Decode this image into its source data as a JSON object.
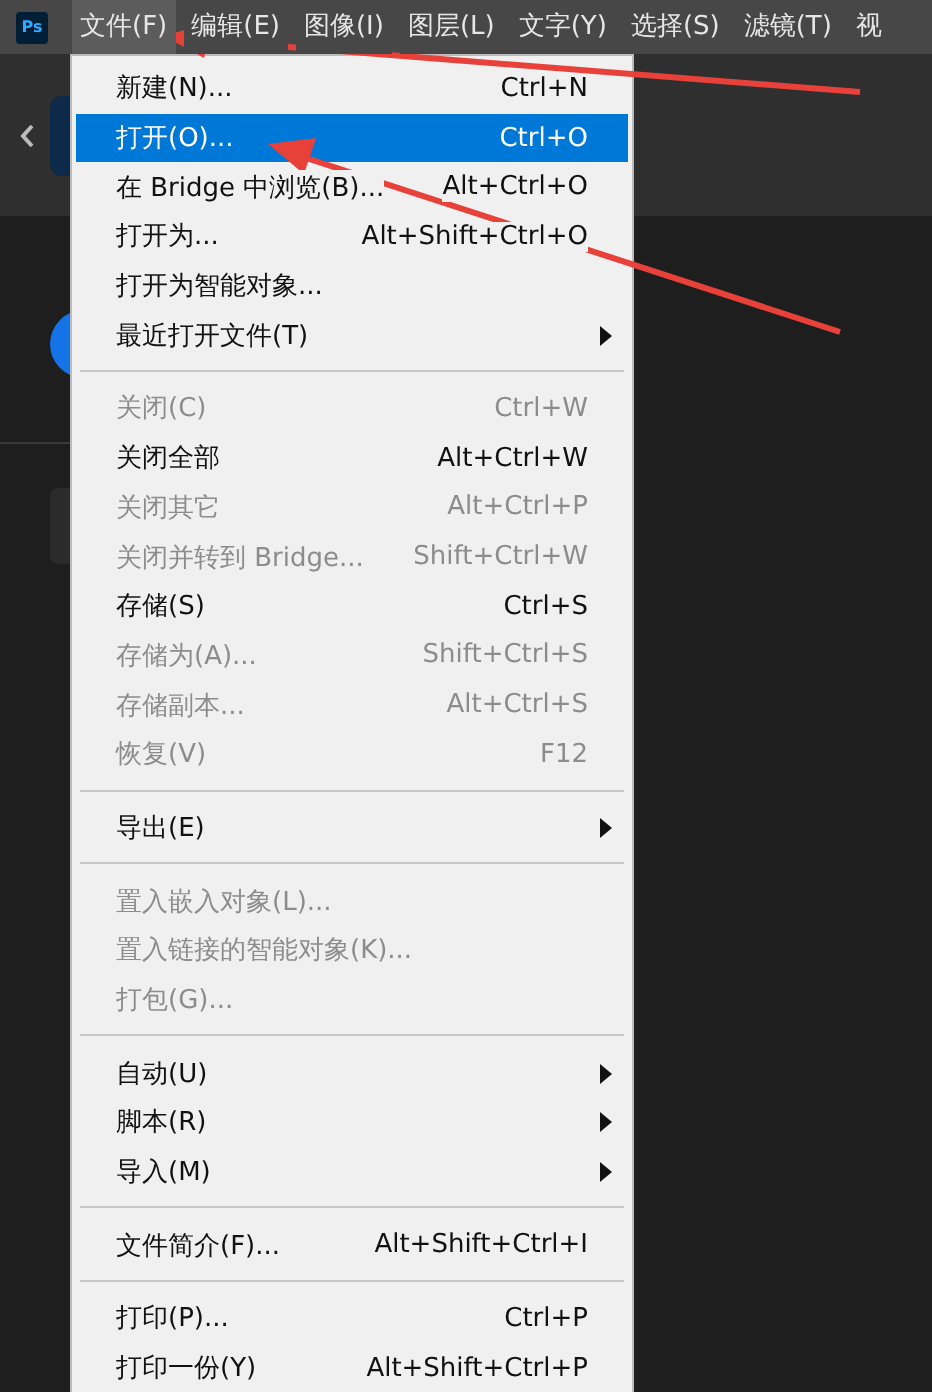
{
  "app_logo": "Ps",
  "menubar": [
    {
      "label": "文件(F)",
      "selected": true
    },
    {
      "label": "编辑(E)",
      "selected": false
    },
    {
      "label": "图像(I)",
      "selected": false
    },
    {
      "label": "图层(L)",
      "selected": false
    },
    {
      "label": "文字(Y)",
      "selected": false
    },
    {
      "label": "选择(S)",
      "selected": false
    },
    {
      "label": "滤镜(T)",
      "selected": false
    },
    {
      "label": "视",
      "selected": false
    }
  ],
  "menu": {
    "sections": [
      [
        {
          "label": "新建(N)...",
          "shortcut": "Ctrl+N",
          "disabled": false,
          "submenu": false,
          "selected": false
        },
        {
          "label": "打开(O)...",
          "shortcut": "Ctrl+O",
          "disabled": false,
          "submenu": false,
          "selected": true
        },
        {
          "label": "在 Bridge 中浏览(B)...",
          "shortcut": "Alt+Ctrl+O",
          "disabled": false,
          "submenu": false,
          "selected": false
        },
        {
          "label": "打开为...",
          "shortcut": "Alt+Shift+Ctrl+O",
          "disabled": false,
          "submenu": false,
          "selected": false
        },
        {
          "label": "打开为智能对象...",
          "disabled": false,
          "submenu": false,
          "selected": false
        },
        {
          "label": "最近打开文件(T)",
          "disabled": false,
          "submenu": true,
          "selected": false
        }
      ],
      [
        {
          "label": "关闭(C)",
          "shortcut": "Ctrl+W",
          "disabled": true,
          "submenu": false,
          "selected": false
        },
        {
          "label": "关闭全部",
          "shortcut": "Alt+Ctrl+W",
          "disabled": false,
          "submenu": false,
          "selected": false
        },
        {
          "label": "关闭其它",
          "shortcut": "Alt+Ctrl+P",
          "disabled": true,
          "submenu": false,
          "selected": false
        },
        {
          "label": "关闭并转到 Bridge...",
          "shortcut": "Shift+Ctrl+W",
          "disabled": true,
          "submenu": false,
          "selected": false
        },
        {
          "label": "存储(S)",
          "shortcut": "Ctrl+S",
          "disabled": false,
          "submenu": false,
          "selected": false
        },
        {
          "label": "存储为(A)...",
          "shortcut": "Shift+Ctrl+S",
          "disabled": true,
          "submenu": false,
          "selected": false
        },
        {
          "label": "存储副本...",
          "shortcut": "Alt+Ctrl+S",
          "disabled": true,
          "submenu": false,
          "selected": false
        },
        {
          "label": "恢复(V)",
          "shortcut": "F12",
          "disabled": true,
          "submenu": false,
          "selected": false
        }
      ],
      [
        {
          "label": "导出(E)",
          "disabled": false,
          "submenu": true,
          "selected": false
        }
      ],
      [
        {
          "label": "置入嵌入对象(L)...",
          "disabled": true,
          "submenu": false,
          "selected": false
        },
        {
          "label": "置入链接的智能对象(K)...",
          "disabled": true,
          "submenu": false,
          "selected": false
        },
        {
          "label": "打包(G)...",
          "disabled": true,
          "submenu": false,
          "selected": false
        }
      ],
      [
        {
          "label": "自动(U)",
          "disabled": false,
          "submenu": true,
          "selected": false
        },
        {
          "label": "脚本(R)",
          "disabled": false,
          "submenu": true,
          "selected": false
        },
        {
          "label": "导入(M)",
          "disabled": false,
          "submenu": true,
          "selected": false
        }
      ],
      [
        {
          "label": "文件简介(F)...",
          "shortcut": "Alt+Shift+Ctrl+I",
          "disabled": false,
          "submenu": false,
          "selected": false
        }
      ],
      [
        {
          "label": "打印(P)...",
          "shortcut": "Ctrl+P",
          "disabled": false,
          "submenu": false,
          "selected": false
        },
        {
          "label": "打印一份(Y)",
          "shortcut": "Alt+Shift+Ctrl+P",
          "disabled": false,
          "submenu": false,
          "selected": false
        }
      ]
    ]
  }
}
